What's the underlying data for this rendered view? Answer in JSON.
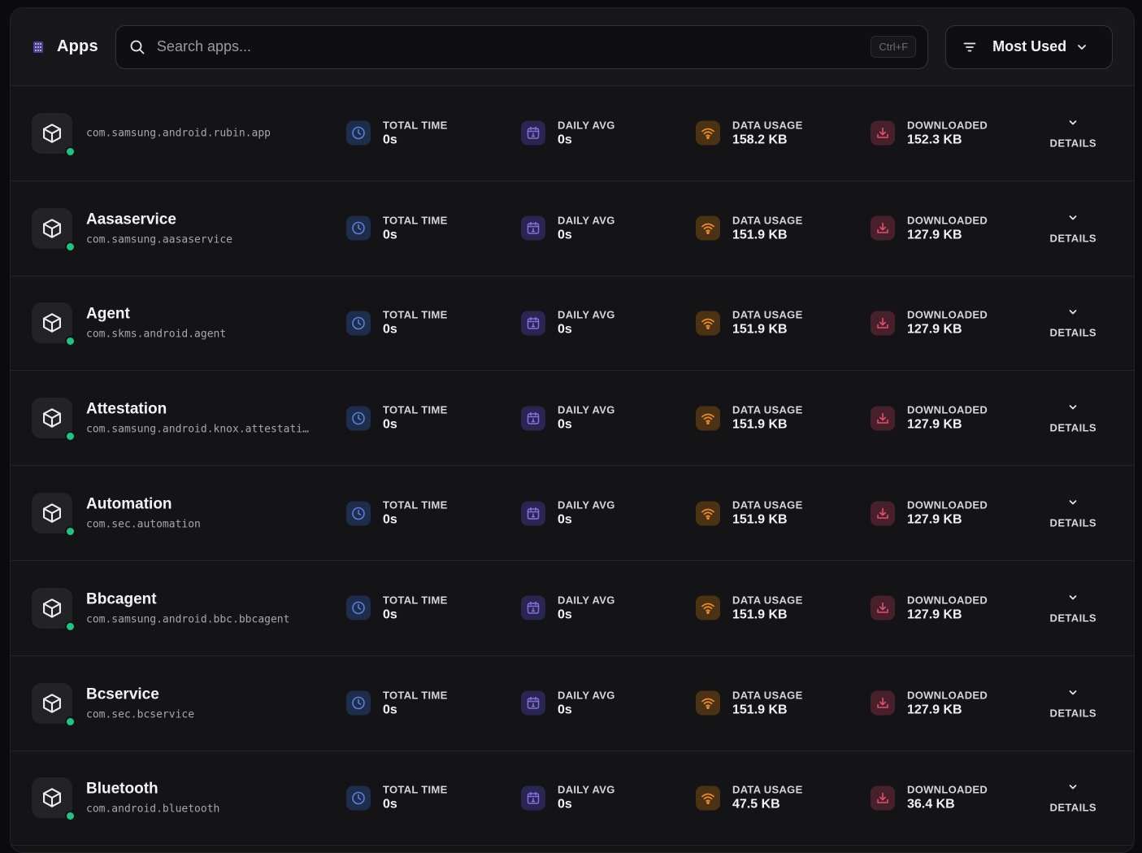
{
  "header": {
    "title": "Apps",
    "search_placeholder": "Search apps...",
    "shortcut": "Ctrl+F",
    "sort_label": "Most Used"
  },
  "labels": {
    "total_time": "TOTAL TIME",
    "daily_avg": "DAILY AVG",
    "data_usage": "DATA USAGE",
    "downloaded": "DOWNLOADED",
    "details": "DETAILS"
  },
  "colors": {
    "status_active": "#1ec47f",
    "time_icon": "#5b7fd6",
    "daily_icon": "#8a6fe0",
    "data_icon": "#f08d2a",
    "download_icon": "#e0506e"
  },
  "apps": [
    {
      "name": "",
      "package": "com.samsung.android.rubin.app",
      "total_time": "0s",
      "daily_avg": "0s",
      "data_usage": "158.2 KB",
      "downloaded": "152.3 KB"
    },
    {
      "name": "Aasaservice",
      "package": "com.samsung.aasaservice",
      "total_time": "0s",
      "daily_avg": "0s",
      "data_usage": "151.9 KB",
      "downloaded": "127.9 KB"
    },
    {
      "name": "Agent",
      "package": "com.skms.android.agent",
      "total_time": "0s",
      "daily_avg": "0s",
      "data_usage": "151.9 KB",
      "downloaded": "127.9 KB"
    },
    {
      "name": "Attestation",
      "package": "com.samsung.android.knox.attestati…",
      "total_time": "0s",
      "daily_avg": "0s",
      "data_usage": "151.9 KB",
      "downloaded": "127.9 KB"
    },
    {
      "name": "Automation",
      "package": "com.sec.automation",
      "total_time": "0s",
      "daily_avg": "0s",
      "data_usage": "151.9 KB",
      "downloaded": "127.9 KB"
    },
    {
      "name": "Bbcagent",
      "package": "com.samsung.android.bbc.bbcagent",
      "total_time": "0s",
      "daily_avg": "0s",
      "data_usage": "151.9 KB",
      "downloaded": "127.9 KB"
    },
    {
      "name": "Bcservice",
      "package": "com.sec.bcservice",
      "total_time": "0s",
      "daily_avg": "0s",
      "data_usage": "151.9 KB",
      "downloaded": "127.9 KB"
    },
    {
      "name": "Bluetooth",
      "package": "com.android.bluetooth",
      "total_time": "0s",
      "daily_avg": "0s",
      "data_usage": "47.5 KB",
      "downloaded": "36.4 KB"
    }
  ]
}
